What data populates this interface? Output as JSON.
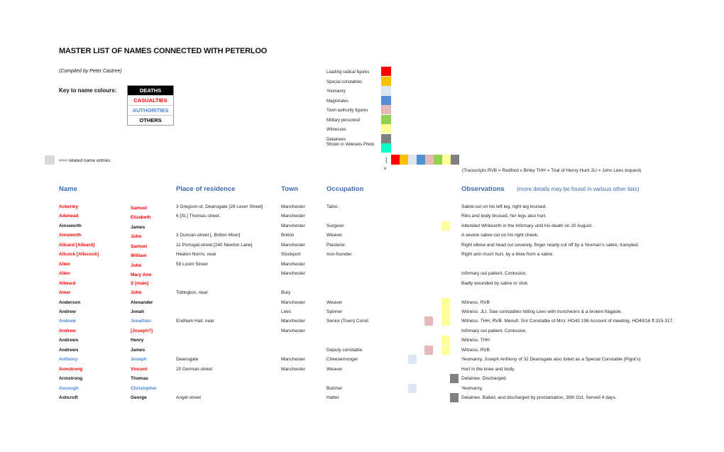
{
  "title": "MASTER LIST OF NAMES CONNECTED WITH PETERLOO",
  "compiled": "(Compiled by Peter Castree)",
  "key": {
    "label": "Key to name colours:",
    "deaths": "DEATHS",
    "casualties": "CASUALTIES",
    "authorities": "AUTHORITIES",
    "others": "OTHERS"
  },
  "colors": {
    "casualty": "#ff0000",
    "authority": "#4a86d8",
    "header": "#3d6bb0"
  },
  "legend": [
    {
      "label": "Leading radical figures",
      "color": "#ff0000"
    },
    {
      "label": "Special constables",
      "color": "#ffc000"
    },
    {
      "label": "Yeomanry",
      "color": "#dce6f2"
    },
    {
      "label": "Magistrates",
      "color": "#558ed5"
    },
    {
      "label": "Town authority figures",
      "color": "#e6b9b8"
    },
    {
      "label": "Military personnel",
      "color": "#92d050"
    },
    {
      "label": "Witnesses",
      "color": "#ffff99"
    },
    {
      "label": "Detainees",
      "color": "#808080"
    },
    {
      "label": "Shown in Veterans Photo",
      "color": "#00ffcc"
    }
  ],
  "related": {
    "label": "<<<  related name entries",
    "color": "#d9d9d9"
  },
  "arrow": {
    "bar": "|",
    "v": "v"
  },
  "transcripts": "(Transcripts   RVB = Redford v Birley   THH = Trial of Henry Hunt   JLI = John Lees Inquest)",
  "headers": {
    "name": "Name",
    "residence": "Place of residence",
    "town": "Town",
    "occupation": "Occupation",
    "observations": "Observations",
    "observations_note": "(more details may be found in various other lists)"
  },
  "rows": [
    {
      "surname": "Ackerley",
      "first": "Samuel",
      "residence": "3 Gregson-st. Deansgate   [29 Lever Street]",
      "town": "Manchester",
      "occupation": "Tailor.",
      "obs": "Sabre-cut on his left leg, right leg bruised.",
      "cls": "red",
      "marks": []
    },
    {
      "surname": "Adshead",
      "first": "Elizabeth",
      "residence": "6 [St.] Thomas-street.",
      "town": "Manchester",
      "occupation": "",
      "obs": "Ribs and body bruised, her legs also hurt.",
      "cls": "red",
      "marks": []
    },
    {
      "surname": "Ainsworth",
      "first": "James",
      "residence": "",
      "town": "Manchester",
      "occupation": "Surgeon",
      "obs": "Attended Whitworth in the Infirmary until his death on 20 August.",
      "cls": "blk",
      "marks": [
        "witness"
      ]
    },
    {
      "surname": "Ainsworth",
      "first": "John",
      "residence": "2 Duncan-street   [, Bolton Moor]",
      "town": "Bolton",
      "occupation": "Weaver.",
      "obs": "A severe sabre-cut on his right cheek.",
      "cls": "red",
      "marks": []
    },
    {
      "surname": "Allcard   [Alleard]",
      "first": "Samuel",
      "residence": "11 Portugal-street   [240 Newton Lane]",
      "town": "Manchester",
      "occupation": "Plasterer.",
      "obs": "Right elbow and head cut severely, finger nearly cut off by a Yeoman's sabre, trampled.",
      "cls": "red",
      "marks": []
    },
    {
      "surname": "Allcock   [Allecock]",
      "first": "William",
      "residence": "Heaton Norris, near",
      "town": "Stockport",
      "occupation": "Iron-founder.",
      "obs": "Right arm much hurt, by a blow from a sabre.",
      "cls": "red",
      "marks": []
    },
    {
      "surname": "Allen",
      "first": "John",
      "residence": "59 Loom Street",
      "town": "Manchester",
      "occupation": "",
      "obs": "",
      "cls": "red",
      "marks": []
    },
    {
      "surname": "Allen",
      "first": "Mary Ann",
      "residence": "",
      "town": "Manchester",
      "occupation": "",
      "obs": "Infirmary out patient. Contusion.",
      "cls": "red",
      "marks": []
    },
    {
      "surname": "Allward",
      "first": "S   [male]",
      "residence": "",
      "town": "",
      "occupation": "",
      "obs": "Badly wounded by sabre or shot.",
      "cls": "red",
      "marks": []
    },
    {
      "surname": "Amer",
      "first": "John",
      "residence": "Tottington,  near",
      "town": "Bury",
      "occupation": "",
      "obs": "",
      "cls": "red",
      "marks": []
    },
    {
      "surname": "Anderson",
      "first": "Alexander",
      "residence": "",
      "town": "Manchester",
      "occupation": "Weaver",
      "obs": "Witness. RVB",
      "cls": "blk",
      "marks": [
        "witness"
      ]
    },
    {
      "surname": "Andrew",
      "first": "Jonah",
      "residence": "",
      "town": "Lees",
      "occupation": "Spinner",
      "obs": "Witness. JLI.  Saw constables hitting Lees with truncheons & a broken flagpole.",
      "cls": "blk",
      "marks": [
        "witness"
      ]
    },
    {
      "surname": "Andrew",
      "first": "Jonathan",
      "residence": "Endham Hall,  near",
      "town": "Manchester",
      "occupation": "Senior (Town) Const.",
      "obs": "Witness. THH,  RVB.  Manufr. Snr Constable of M/cr.  HO42 196  Account of meeting. HO40/16 ff.315-317.",
      "cls": "blue",
      "marks": [
        "town",
        "witness"
      ]
    },
    {
      "surname": "Andrew",
      "first": "[Joseph?]",
      "residence": "",
      "town": "Manchester",
      "occupation": "",
      "obs": "Infirmary out patient. Contusion.",
      "cls": "red",
      "marks": []
    },
    {
      "surname": "Andrews",
      "first": "Henry",
      "residence": "",
      "town": "",
      "occupation": "",
      "obs": "Witness. THH",
      "cls": "blk",
      "marks": [
        "witness"
      ]
    },
    {
      "surname": "Andrews",
      "first": "James",
      "residence": "",
      "town": "",
      "occupation": "Deputy constable",
      "obs": "Witness. RVB",
      "cls": "blk",
      "marks": [
        "town",
        "witness"
      ]
    },
    {
      "surname": "Anthony",
      "first": "Joseph",
      "residence": "Deansgate",
      "town": "Manchester",
      "occupation": "Cheesemonger",
      "obs": "Yeomanry.  Joseph Anthony of 32 Deansgate also listed as a Special Constable (Pigot's)",
      "cls": "blue",
      "marks": [
        "yeomanry"
      ]
    },
    {
      "surname": "Armstrong",
      "first": "Vincent",
      "residence": "20 German-street.",
      "town": "Manchester",
      "occupation": "Weaver.",
      "obs": "Hurt in the knee and body",
      "cls": "red",
      "marks": []
    },
    {
      "surname": "Armstrong",
      "first": "Thomas",
      "residence": "",
      "town": "",
      "occupation": "",
      "obs": "Detainee. Discharged.",
      "cls": "blk",
      "marks": [
        "detainee"
      ]
    },
    {
      "surname": "Ascough",
      "first": "Christopher",
      "residence": "",
      "town": "",
      "occupation": "Butcher",
      "obs": "Yeomanry.",
      "cls": "blue",
      "marks": [
        "yeomanry"
      ]
    },
    {
      "surname": "Ashcroft",
      "first": "George",
      "residence": "Angel-street",
      "town": "",
      "occupation": "Hatter",
      "obs": "Detainee. Bailed, and discharged by proclamation, 30th Oct.  Served 4 days.",
      "cls": "blk",
      "marks": [
        "detainee"
      ]
    }
  ]
}
